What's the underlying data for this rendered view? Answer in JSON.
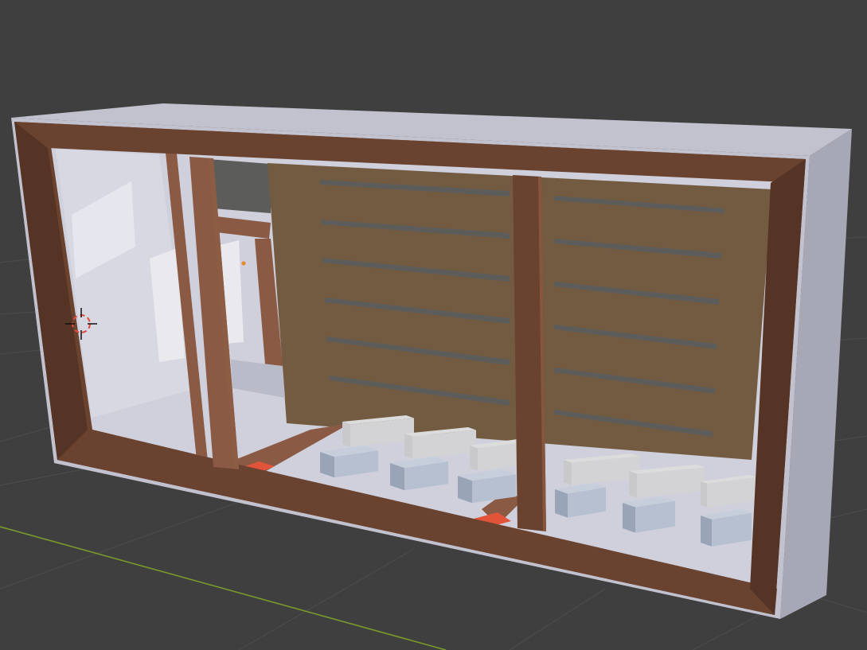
{
  "viewport": {
    "background": "#3f3f3f",
    "grid_line_color": "#4b4b4b",
    "x_axis_color": "#7a9a2a"
  },
  "colors": {
    "outer_shell": "#c2c2cf",
    "outer_shell_shade": "#a7a8b6",
    "frame_wood": "#6a4230",
    "frame_wood_dark": "#553425",
    "frame_wood_light": "#8a5a44",
    "back_panel": "#735b41",
    "vent_slot": "#5c5c5a",
    "glass_pane": "#d7d8e2",
    "floor": "#cfd0dc",
    "cube_light": "#dcdcdc",
    "cube_blue": "#b7c0d0",
    "cube_blue_side": "#99a4b6",
    "red_marker": "#e1543a",
    "origin_dot": "#e88a2c",
    "cursor_red": "#e34b3a",
    "cursor_white": "#f2f2f2"
  },
  "icons": {
    "cursor": "3d-cursor-icon",
    "origin": "object-origin-icon"
  }
}
